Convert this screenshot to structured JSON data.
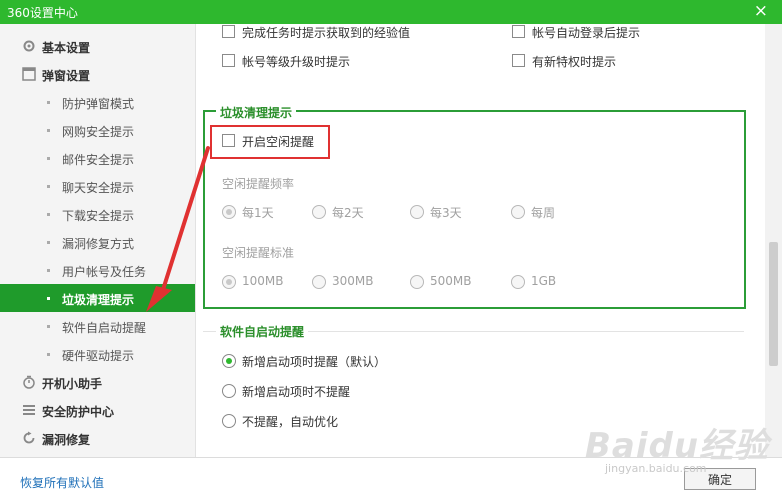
{
  "window": {
    "title": "360设置中心",
    "close_glyph": "×"
  },
  "sidebar": {
    "groups": [
      {
        "label": "基本设置",
        "icon": "gear-icon"
      },
      {
        "label": "弹窗设置",
        "icon": "window-icon"
      },
      {
        "label": "开机小助手",
        "icon": "timer-icon"
      },
      {
        "label": "安全防护中心",
        "icon": "list-icon"
      },
      {
        "label": "漏洞修复",
        "icon": "refresh-icon"
      }
    ],
    "popup_items": [
      "防护弹窗模式",
      "网购安全提示",
      "邮件安全提示",
      "聊天安全提示",
      "下载安全提示",
      "漏洞修复方式",
      "用户帐号及任务",
      "垃圾清理提示",
      "软件自启动提醒",
      "硬件驱动提示"
    ],
    "active_item": "垃圾清理提示"
  },
  "content": {
    "account_options": [
      {
        "label": "完成任务时提示获取到的经验值",
        "checked": false
      },
      {
        "label": "帐号自动登录后提示",
        "checked": false
      },
      {
        "label": "帐号等级升级时提示",
        "checked": false
      },
      {
        "label": "有新特权时提示",
        "checked": false
      }
    ],
    "cleanup": {
      "legend": "垃圾清理提示",
      "enable_label": "开启空闲提醒",
      "enabled": false,
      "frequency_heading": "空闲提醒频率",
      "frequency_options": [
        "每1天",
        "每2天",
        "每3天",
        "每周"
      ],
      "frequency_selected": "每1天",
      "threshold_heading": "空闲提醒标准",
      "threshold_options": [
        "100MB",
        "300MB",
        "500MB",
        "1GB"
      ],
      "threshold_selected": "100MB"
    },
    "startup": {
      "legend": "软件自启动提醒",
      "options": [
        "新增启动项时提醒（默认）",
        "新增启动项时不提醒",
        "不提醒，自动优化"
      ],
      "selected": "新增启动项时提醒（默认）"
    }
  },
  "footer": {
    "restore_label": "恢复所有默认值",
    "ok_label": "确定"
  },
  "watermark": {
    "brand": "Baidu经验",
    "url": "jingyan.baidu.com"
  },
  "colors": {
    "titlebar": "#2eb82e",
    "active_nav": "#1f9b2b",
    "section_border": "#2b9d37",
    "annotation": "#e03131",
    "link": "#1d6fb8"
  }
}
